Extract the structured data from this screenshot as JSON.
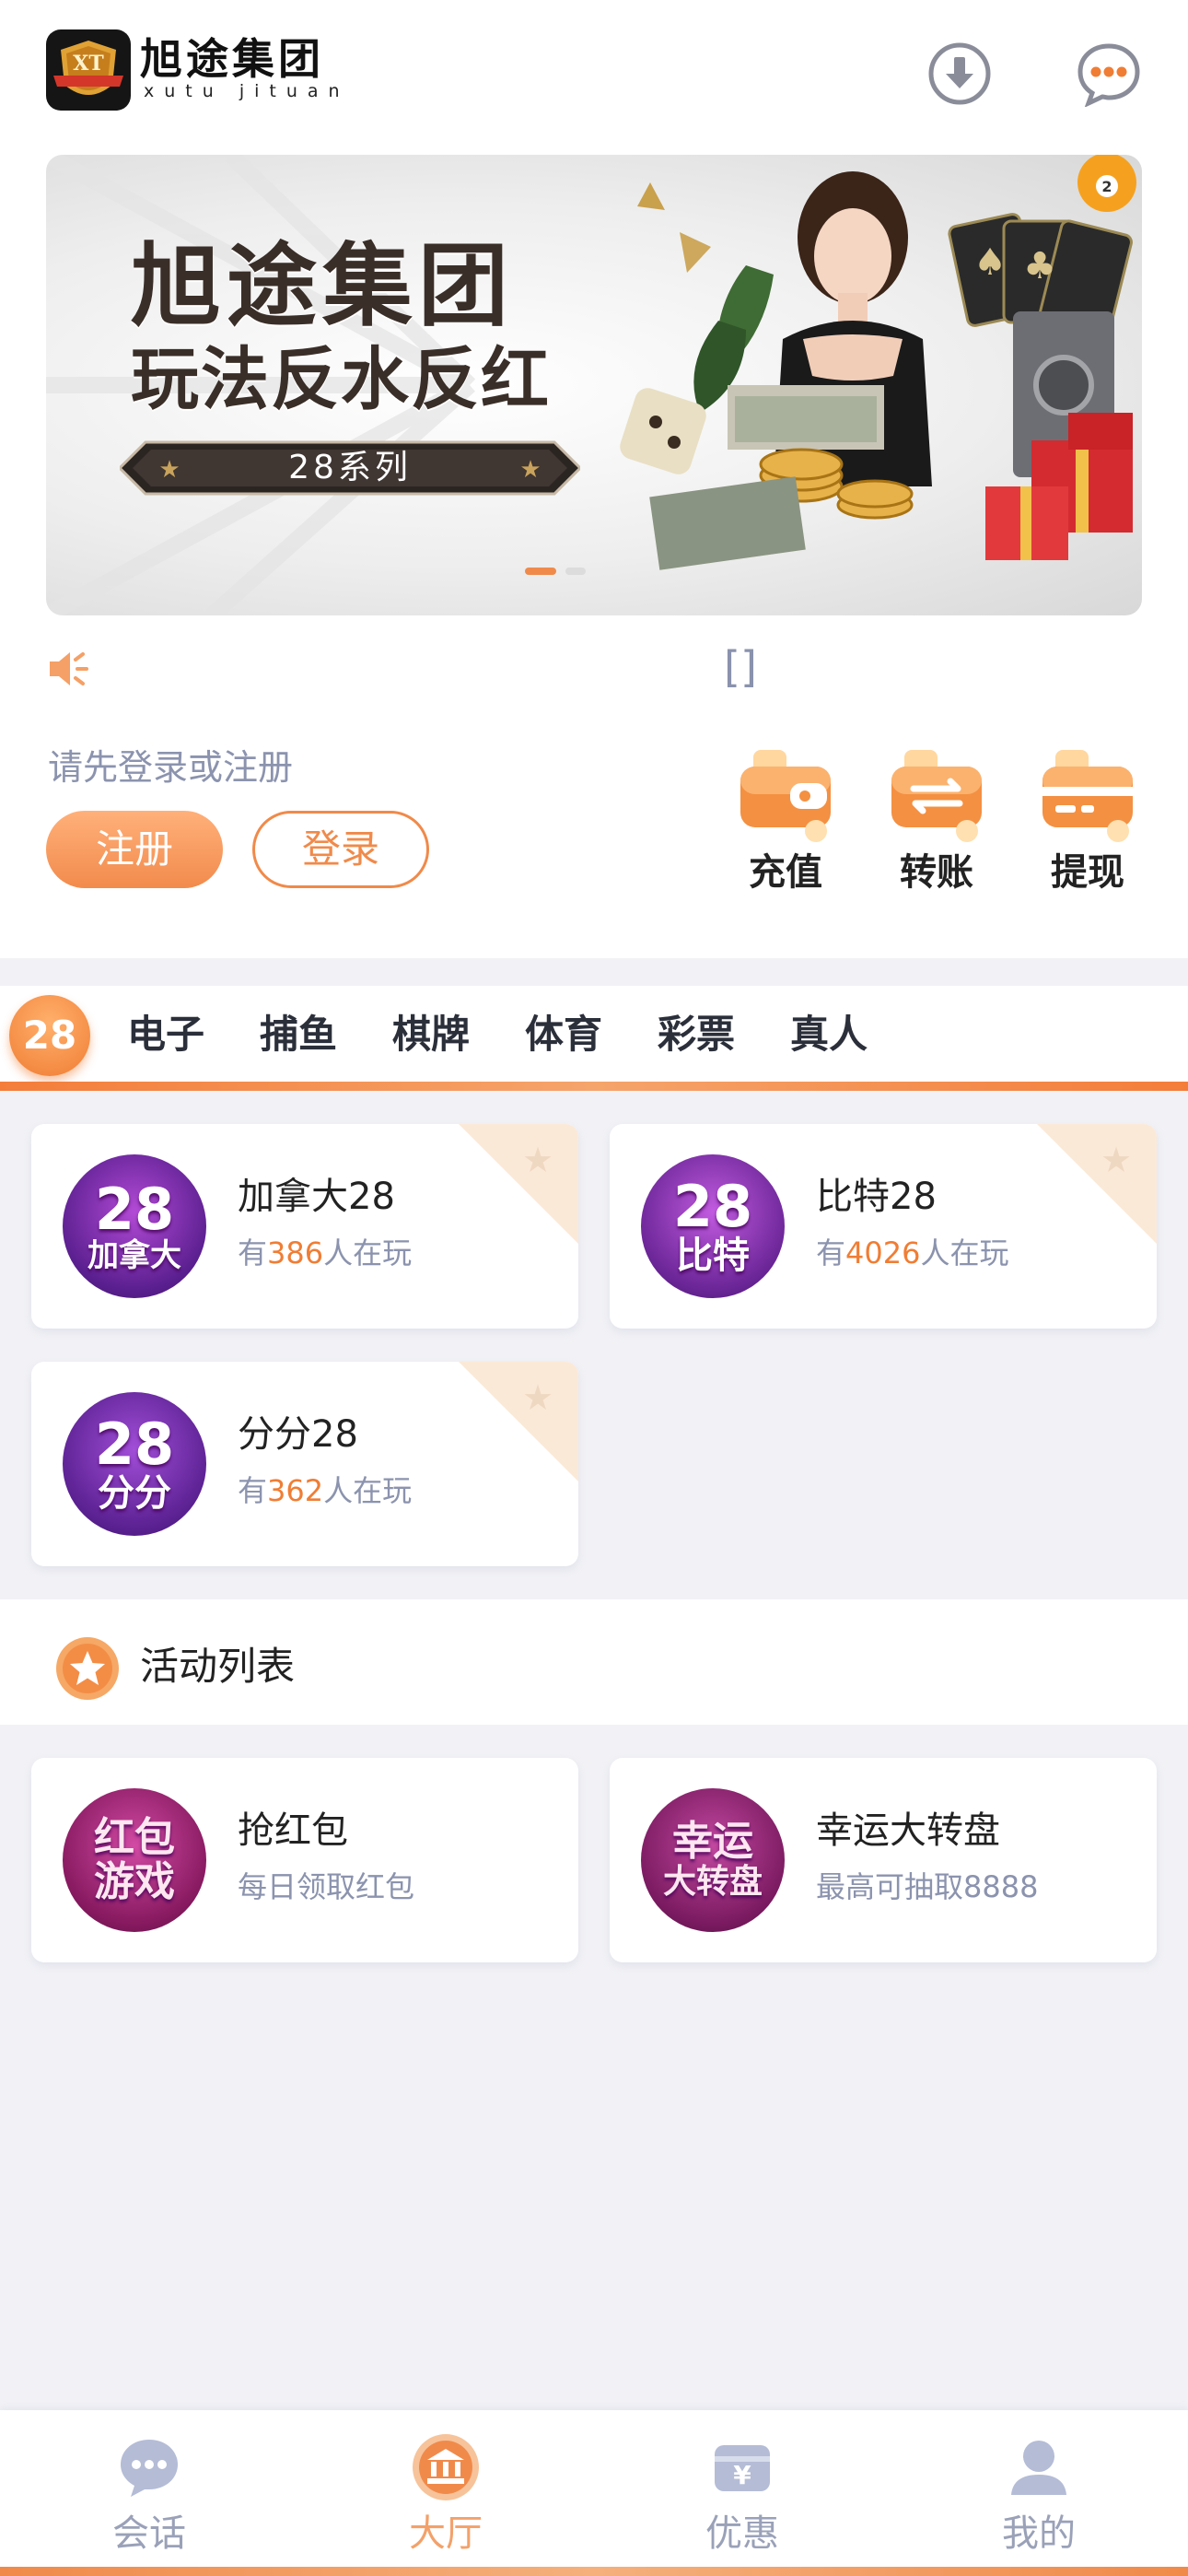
{
  "header": {
    "brand_name": "旭途集团",
    "brand_sub": "xutu jituan",
    "logo_mark": "XT",
    "download_icon": "download-icon",
    "chat_icon": "chat-bubble-icon"
  },
  "banner": {
    "title": "旭途集团",
    "subtitle": "玩法反水反红",
    "series_label": "28系列"
  },
  "notice": {
    "icon": "speaker-icon",
    "text": "[]"
  },
  "account": {
    "login_hint": "请先登录或注册",
    "register_label": "注册",
    "login_label": "登录"
  },
  "wallet_actions": [
    {
      "label": "充值",
      "icon": "wallet-icon"
    },
    {
      "label": "转账",
      "icon": "transfer-icon"
    },
    {
      "label": "提现",
      "icon": "card-icon"
    }
  ],
  "category_tabs": {
    "active": "28",
    "items": [
      "电子",
      "捕鱼",
      "棋牌",
      "体育",
      "彩票",
      "真人"
    ]
  },
  "games": [
    {
      "name": "加拿大28",
      "icon_line1": "28",
      "icon_line2": "加拿大",
      "prefix": "有",
      "count": "386",
      "suffix": "人在玩"
    },
    {
      "name": "比特28",
      "icon_line1": "28",
      "icon_line2": "比特",
      "prefix": "有",
      "count": "4026",
      "suffix": "人在玩"
    },
    {
      "name": "分分28",
      "icon_line1": "28",
      "icon_line2": "分分",
      "prefix": "有",
      "count": "362",
      "suffix": "人在玩"
    }
  ],
  "activity_section": {
    "title": "活动列表",
    "items": [
      {
        "name": "抢红包",
        "desc": "每日领取红包",
        "icon_line1": "红包",
        "icon_line2": "游戏"
      },
      {
        "name": "幸运大转盘",
        "desc": "最高可抽取8888",
        "icon_line1": "幸运",
        "icon_line2": "大转盘"
      }
    ]
  },
  "bottom_nav": [
    {
      "label": "会话",
      "icon": "chat-icon",
      "active": false
    },
    {
      "label": "大厅",
      "icon": "hall-icon",
      "active": true
    },
    {
      "label": "优惠",
      "icon": "coupon-icon",
      "active": false
    },
    {
      "label": "我的",
      "icon": "user-icon",
      "active": false
    }
  ],
  "colors": {
    "accent": "#f08a4a",
    "muted_text": "#8b93ae",
    "page_bg": "#f2f2f6"
  }
}
